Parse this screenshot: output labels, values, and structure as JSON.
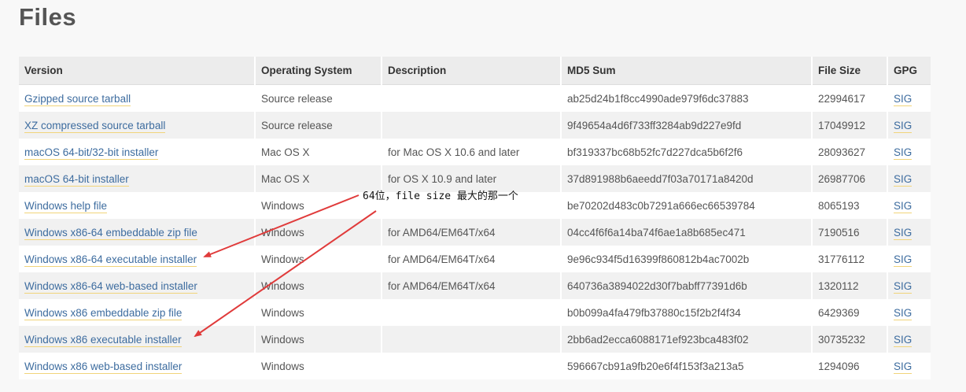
{
  "page": {
    "title": "Files"
  },
  "table": {
    "headers": {
      "version": "Version",
      "os": "Operating System",
      "description": "Description",
      "md5": "MD5 Sum",
      "size": "File Size",
      "gpg": "GPG"
    },
    "rows": [
      {
        "version": "Gzipped source tarball",
        "os": "Source release",
        "description": "",
        "md5": "ab25d24b1f8cc4990ade979f6dc37883",
        "size": "22994617",
        "gpg": "SIG"
      },
      {
        "version": "XZ compressed source tarball",
        "os": "Source release",
        "description": "",
        "md5": "9f49654a4d6f733ff3284ab9d227e9fd",
        "size": "17049912",
        "gpg": "SIG"
      },
      {
        "version": "macOS 64-bit/32-bit installer",
        "os": "Mac OS X",
        "description": "for Mac OS X 10.6 and later",
        "md5": "bf319337bc68b52fc7d227dca5b6f2f6",
        "size": "28093627",
        "gpg": "SIG"
      },
      {
        "version": "macOS 64-bit installer",
        "os": "Mac OS X",
        "description": "for OS X 10.9 and later",
        "md5": "37d891988b6aeedd7f03a70171a8420d",
        "size": "26987706",
        "gpg": "SIG"
      },
      {
        "version": "Windows help file",
        "os": "Windows",
        "description": "",
        "md5": "be70202d483c0b7291a666ec66539784",
        "size": "8065193",
        "gpg": "SIG"
      },
      {
        "version": "Windows x86-64 embeddable zip file",
        "os": "Windows",
        "description": "for AMD64/EM64T/x64",
        "md5": "04cc4f6f6a14ba74f6ae1a8b685ec471",
        "size": "7190516",
        "gpg": "SIG"
      },
      {
        "version": "Windows x86-64 executable installer",
        "os": "Windows",
        "description": "for AMD64/EM64T/x64",
        "md5": "9e96c934f5d16399f860812b4ac7002b",
        "size": "31776112",
        "gpg": "SIG"
      },
      {
        "version": "Windows x86-64 web-based installer",
        "os": "Windows",
        "description": "for AMD64/EM64T/x64",
        "md5": "640736a3894022d30f7babff77391d6b",
        "size": "1320112",
        "gpg": "SIG"
      },
      {
        "version": "Windows x86 embeddable zip file",
        "os": "Windows",
        "description": "",
        "md5": "b0b099a4fa479fb37880c15f2b2f4f34",
        "size": "6429369",
        "gpg": "SIG"
      },
      {
        "version": "Windows x86 executable installer",
        "os": "Windows",
        "description": "",
        "md5": "2bb6ad2ecca6088171ef923bca483f02",
        "size": "30735232",
        "gpg": "SIG"
      },
      {
        "version": "Windows x86 web-based installer",
        "os": "Windows",
        "description": "",
        "md5": "596667cb91a9fb20e6f4f153f3a213a5",
        "size": "1294096",
        "gpg": "SIG"
      }
    ]
  },
  "annotation": {
    "note": "64位，file size 最大的那一个",
    "arrow_color": "#e03b3b"
  },
  "colors": {
    "link": "#3d6c9f",
    "link_underline": "#f1d47a",
    "header_bg": "#ececec",
    "row_alt_bg": "#f1f1f1"
  }
}
